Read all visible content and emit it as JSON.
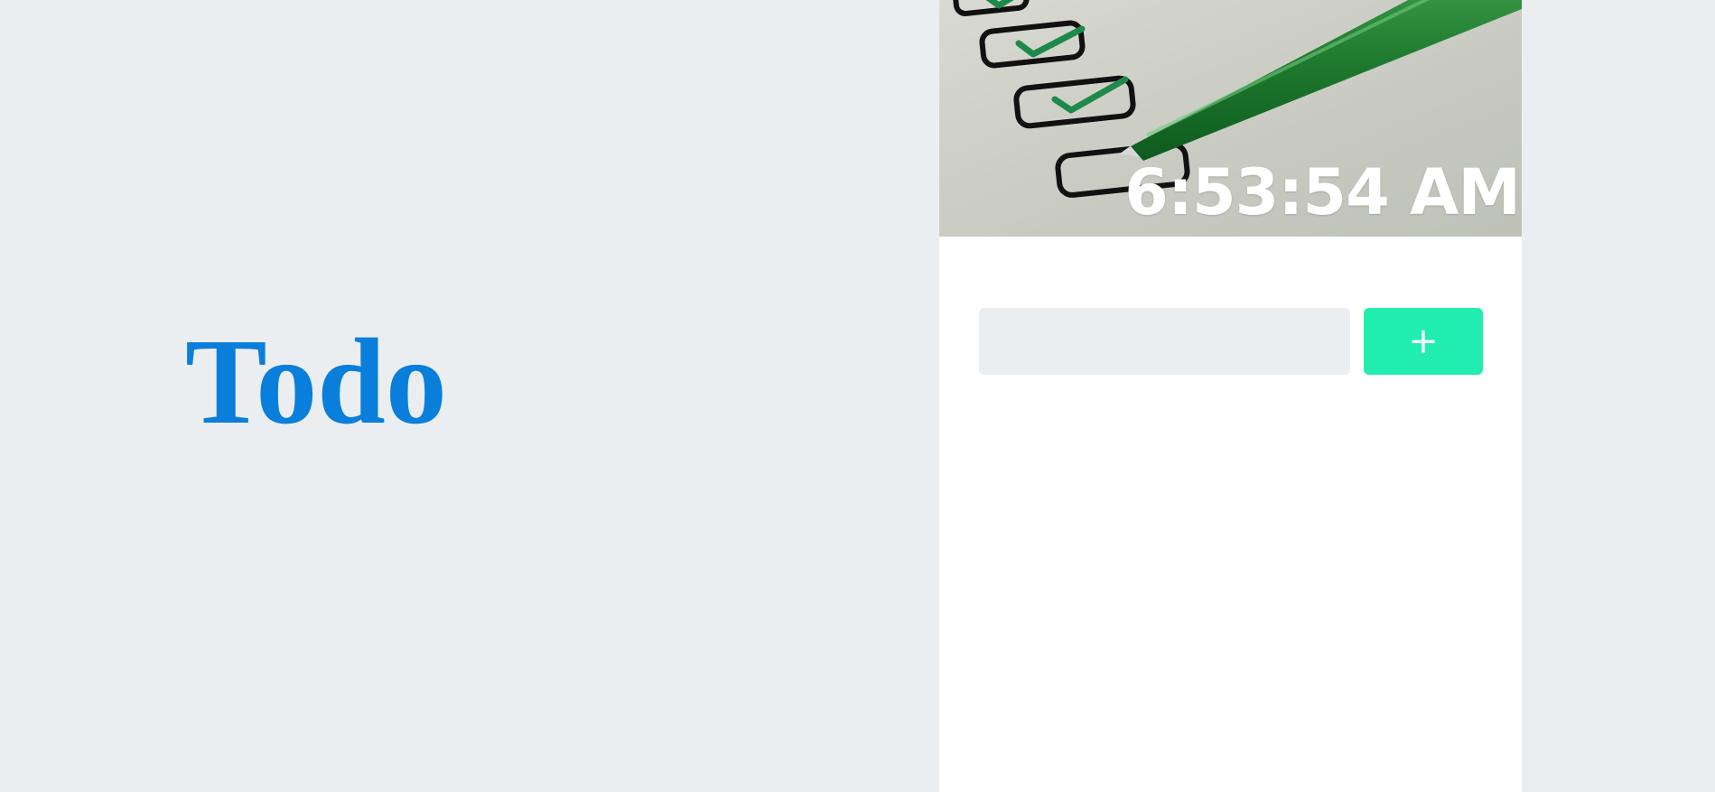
{
  "app": {
    "title": "Todo"
  },
  "header": {
    "clock_time": "6:53:54 AM",
    "image_icon": "checklist-pen-image"
  },
  "form": {
    "input_value": "",
    "add_button_label": "+"
  },
  "colors": {
    "page_background": "#EBEEF1",
    "title_blue": "#0A7EDB",
    "panel_background": "#FFFFFF",
    "add_button": "#21EDAE",
    "input_background": "#EBEEF1"
  }
}
